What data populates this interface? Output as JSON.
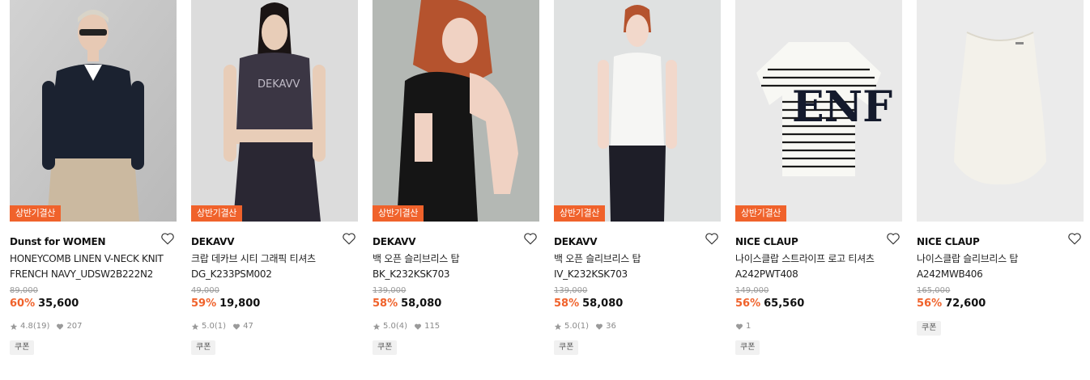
{
  "badge_label": "상반기결산",
  "coupon_label": "쿠폰",
  "products": [
    {
      "brand": "Dunst for WOMEN",
      "name_line1": "HONEYCOMB LINEN V-NECK KNIT",
      "name_line2": "FRENCH NAVY_UDSW2B222N2",
      "original_price": "89,000",
      "discount": "60%",
      "price": "35,600",
      "rating": "4.8",
      "reviews": "(19)",
      "likes": "207",
      "has_badge": true,
      "has_coupon": true
    },
    {
      "brand": "DEKAVV",
      "name_line1": "크랍 데카브 시티 그래픽 티셔츠",
      "name_line2": "DG_K233PSM002",
      "original_price": "49,000",
      "discount": "59%",
      "price": "19,800",
      "rating": "5.0",
      "reviews": "(1)",
      "likes": "47",
      "has_badge": true,
      "has_coupon": true
    },
    {
      "brand": "DEKAVV",
      "name_line1": "백 오픈 슬리브리스 탑",
      "name_line2": "BK_K232KSK703",
      "original_price": "139,000",
      "discount": "58%",
      "price": "58,080",
      "rating": "5.0",
      "reviews": "(4)",
      "likes": "115",
      "has_badge": true,
      "has_coupon": true
    },
    {
      "brand": "DEKAVV",
      "name_line1": "백 오픈 슬리브리스 탑",
      "name_line2": "IV_K232KSK703",
      "original_price": "139,000",
      "discount": "58%",
      "price": "58,080",
      "rating": "5.0",
      "reviews": "(1)",
      "likes": "36",
      "has_badge": true,
      "has_coupon": true
    },
    {
      "brand": "NICE CLAUP",
      "name_line1": "나이스클랍 스트라이프 로고 티셔츠",
      "name_line2": "A242PWT408",
      "original_price": "149,000",
      "discount": "56%",
      "price": "65,560",
      "rating": "",
      "reviews": "",
      "likes": "1",
      "has_badge": true,
      "has_coupon": true
    },
    {
      "brand": "NICE CLAUP",
      "name_line1": "나이스클랍 슬리브리스 탑",
      "name_line2": "A242MWB406",
      "original_price": "165,000",
      "discount": "56%",
      "price": "72,600",
      "rating": "",
      "reviews": "",
      "likes": "",
      "has_badge": false,
      "has_coupon": true
    }
  ],
  "colors": {
    "accent": "#f0622b",
    "muted": "#8a8a8a"
  }
}
